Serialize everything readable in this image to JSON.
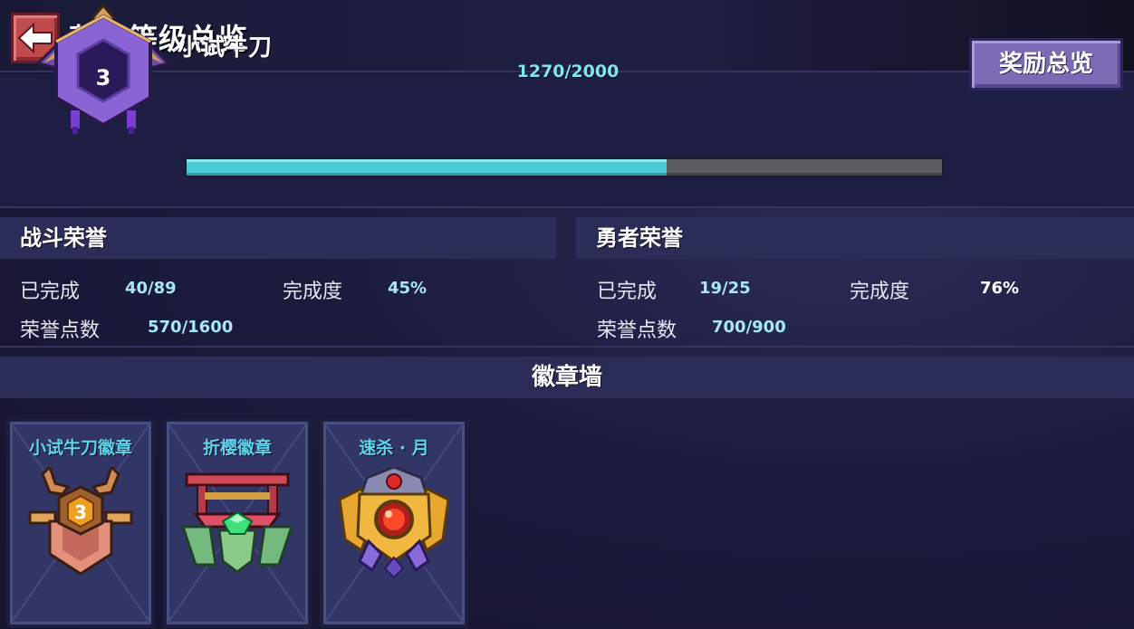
{
  "header": {
    "title": "荣誉等级总览",
    "back_icon": "back-arrow-icon"
  },
  "rank": {
    "level": "3",
    "name": "小试牛刀",
    "xp_text": "1270/2000",
    "xp_progress": 0.635,
    "reward_button": "奖励总览"
  },
  "battle_honor": {
    "title": "战斗荣誉",
    "completed_label": "已完成",
    "completed_value": "40/89",
    "degree_label": "完成度",
    "degree_value": "45%",
    "points_label": "荣誉点数",
    "points_value": "570/1600"
  },
  "hero_honor": {
    "title": "勇者荣誉",
    "completed_label": "已完成",
    "completed_value": "19/25",
    "degree_label": "完成度",
    "degree_value": "76%",
    "points_label": "荣誉点数",
    "points_value": "700/900"
  },
  "badge_wall": {
    "title": "徽章墙",
    "badges": [
      {
        "name": "小试牛刀徽章",
        "badge_number": "3",
        "icon": "horned-shield-badge-icon"
      },
      {
        "name": "折樱徽章",
        "icon": "torii-emerald-badge-icon"
      },
      {
        "name": "速杀 · 月",
        "icon": "golden-crest-ruby-badge-icon"
      }
    ]
  },
  "colors": {
    "background": "#1b1b3c",
    "xp_fill": "#4cc9d6",
    "badge_name": "#5fd2ec",
    "reward_button": "#7a6bb4",
    "back_button": "#c04a4e"
  }
}
